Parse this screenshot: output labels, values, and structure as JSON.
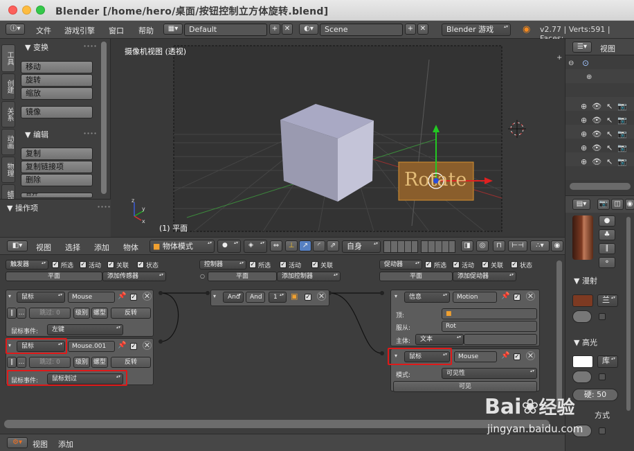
{
  "window": {
    "title": "Blender [/home/hero/桌面/按钮控制立方体旋转.blend]"
  },
  "menubar": {
    "items": [
      "文件",
      "游戏引擎",
      "窗口",
      "帮助"
    ],
    "layout": "Default",
    "scene": "Scene",
    "engine": "Blender 游戏",
    "stats": "v2.77 | Verts:591 | Faces:"
  },
  "toolshelf": {
    "tabs": [
      "工具",
      "创建",
      "关系",
      "动画",
      "物理",
      "蜡笔"
    ],
    "transform_header": "▼ 变换",
    "transform_buttons": [
      "移动",
      "旋转",
      "缩放"
    ],
    "mirror": "镜像",
    "edit_header": "▼ 编辑",
    "edit_buttons": [
      "复制",
      "复制链接项",
      "删除"
    ],
    "cut_partial": "合并",
    "ops_header": "▼ 操作项"
  },
  "viewport": {
    "label": "摄像机视图 (透视)",
    "object_label": "(1) 平面",
    "rotate_text": "Rotate"
  },
  "header3d": {
    "menu": [
      "视图",
      "选择",
      "添加",
      "物体"
    ],
    "mode": "物体模式",
    "orientation": "自身"
  },
  "logic": {
    "sensors": {
      "title": "触发器",
      "add_btn": "添加传感器",
      "tab": "平面"
    },
    "controllers": {
      "title": "控制器",
      "add_btn": "添加控制器",
      "tab": "平面"
    },
    "actuators": {
      "title": "促动器",
      "add_btn": "添加促动器",
      "tab": "平面"
    },
    "flags": [
      "所选",
      "活动",
      "关联",
      "状态"
    ],
    "sensor1": {
      "type": "鼠标",
      "name": "Mouse",
      "event_label": "鼠标事件:",
      "event": "左键"
    },
    "sensor2": {
      "type": "鼠标",
      "name": "Mouse.001",
      "event_label": "鼠标事件:",
      "event": "鼠标划过"
    },
    "sensor_row": {
      "skip": "跳过:",
      "skip_val": "0",
      "level": "级别",
      "tap": "螺型",
      "invert": "反转"
    },
    "controller": {
      "type": "And",
      "name": "And",
      "state": "1"
    },
    "actuator1": {
      "type": "信息",
      "name": "Motion",
      "to_label": "顶:",
      "subject_label": "服从:",
      "subject": "Rot",
      "body_label": "主体:",
      "body": "文本"
    },
    "actuator2": {
      "type": "鼠标",
      "name": "Mouse",
      "mode_label": "模式:",
      "mode": "可见性",
      "visible": "可见"
    }
  },
  "footer": {
    "menu": [
      "视图",
      "添加"
    ]
  },
  "outliner": {
    "view": "视图"
  },
  "properties": {
    "diffuse": "▼ 漫射",
    "diffuse_shader": "兰",
    "specular": "▼ 高光",
    "spec_shader": "库",
    "hardness": "硬: 50",
    "shading": "方式"
  },
  "watermark": {
    "logo": "Bai",
    "logo2": "经验",
    "url": "jingyan.baidu.com"
  },
  "colors": {
    "accent": "#e01919",
    "brand_blue": "#2e6fd6",
    "diffuse_swatch": "#7d3a22"
  }
}
